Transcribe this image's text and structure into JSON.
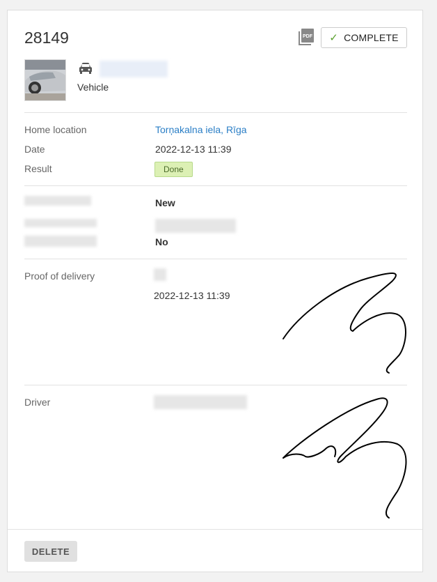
{
  "header": {
    "title": "28149",
    "pdf_icon": "pdf-icon",
    "complete_label": "COMPLETE",
    "check_icon": "check-icon"
  },
  "vehicle": {
    "thumbnail": "car-photo",
    "icon": "car-icon",
    "label": "Vehicle"
  },
  "details": {
    "home_location_label": "Home location",
    "home_location_value": "Torņakalna iela, Rīga",
    "date_label": "Date",
    "date_value": "2022-12-13 11:39",
    "result_label": "Result",
    "result_value": "Done"
  },
  "extra": {
    "row1_value": "New",
    "row3_value": "No"
  },
  "proof": {
    "label": "Proof of delivery",
    "date_value": "2022-12-13 11:39"
  },
  "driver": {
    "label": "Driver"
  },
  "footer": {
    "delete_label": "DELETE"
  },
  "colors": {
    "link": "#2a7ec6",
    "done_badge_bg": "#dcf0b4",
    "check": "#5aa02c"
  }
}
